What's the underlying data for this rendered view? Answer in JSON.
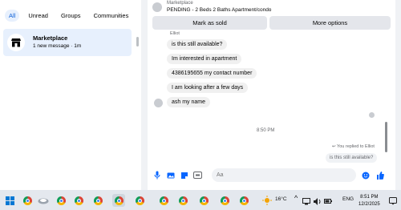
{
  "filters": [
    "All",
    "Unread",
    "Groups",
    "Communities"
  ],
  "conversation": {
    "title": "Marketplace",
    "subtitle": "1 new message · 1m"
  },
  "header": {
    "name": "Marketplace",
    "status": "PENDING - 2 Beds 2 Baths Apartment/condo"
  },
  "actions": {
    "mark_sold": "Mark as sold",
    "more_options": "More options"
  },
  "sender_name": "Elliot",
  "messages": [
    "is this still available?",
    "Im interested in apartment",
    "4386195655 my contact number",
    "I am looking after a few days",
    "ash my name"
  ],
  "timestamp": "8:50 PM",
  "reply": {
    "label": "You replied to Elliot",
    "quoted": "is this still available?"
  },
  "composer": {
    "placeholder": "Aa"
  },
  "system": {
    "temperature": "16°C",
    "language": "ENG",
    "time": "8:51 PM",
    "date": "12/2/2025"
  },
  "colors": {
    "accent": "#0a5fd8",
    "messenger_blue": "#0866ff"
  }
}
